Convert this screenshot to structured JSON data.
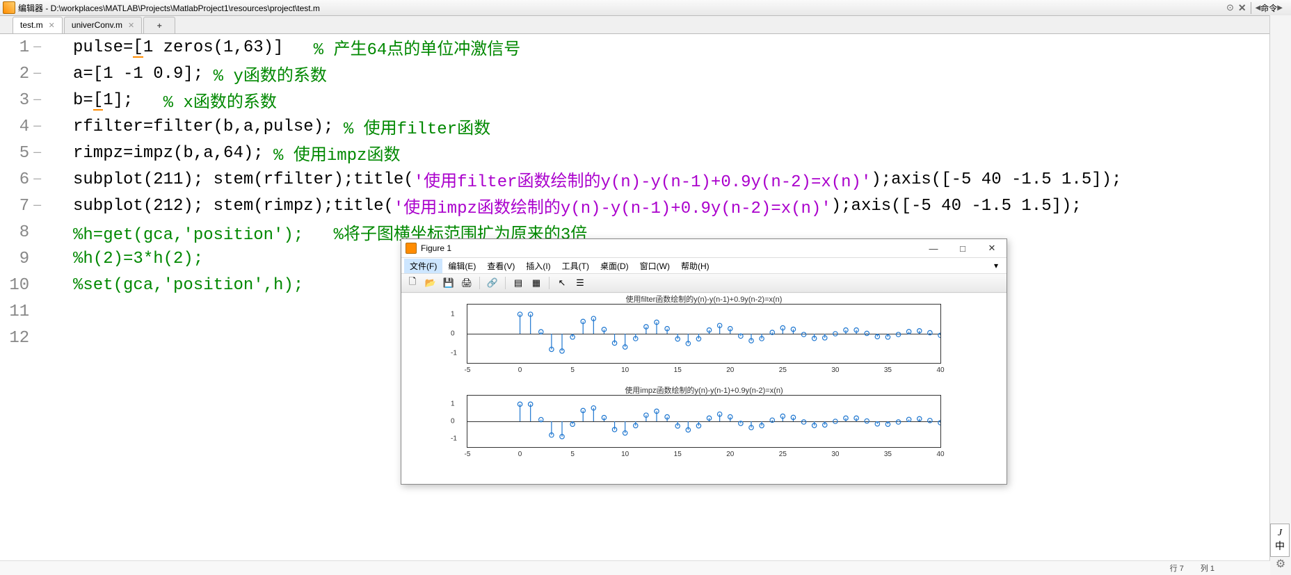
{
  "window": {
    "title": "编辑器 - D:\\workplaces\\MATLAB\\Projects\\MatlabProject1\\resources\\project\\test.m",
    "panel_btn": "命令"
  },
  "tabs": [
    {
      "label": "test.m",
      "active": true
    },
    {
      "label": "univerConv.m",
      "active": false
    }
  ],
  "code_lines": [
    {
      "n": 1,
      "dash": true,
      "segs": [
        [
          "plain",
          "pulse="
        ],
        [
          "ul",
          "["
        ],
        [
          "plain",
          "1 zeros(1,63)]   "
        ],
        [
          "cmt",
          "% 产生64点的单位冲激信号"
        ]
      ]
    },
    {
      "n": 2,
      "dash": true,
      "segs": [
        [
          "plain",
          "a=[1 -1 0.9]; "
        ],
        [
          "cmt",
          "% y函数的系数"
        ]
      ]
    },
    {
      "n": 3,
      "dash": true,
      "segs": [
        [
          "plain",
          "b="
        ],
        [
          "ul",
          "["
        ],
        [
          "plain",
          "1];   "
        ],
        [
          "cmt",
          "% x函数的系数"
        ]
      ]
    },
    {
      "n": 4,
      "dash": true,
      "segs": [
        [
          "plain",
          "rfilter=filter(b,a,pulse); "
        ],
        [
          "cmt",
          "% 使用filter函数"
        ]
      ]
    },
    {
      "n": 5,
      "dash": true,
      "segs": [
        [
          "plain",
          "rimpz=impz(b,a,64); "
        ],
        [
          "cmt",
          "% 使用impz函数"
        ]
      ]
    },
    {
      "n": 6,
      "dash": true,
      "segs": [
        [
          "plain",
          "subplot(211); stem(rfilter);title("
        ],
        [
          "str",
          "'使用filter函数绘制的y(n)-y(n-1)+0.9y(n-2)=x(n)'"
        ],
        [
          "plain",
          ");axis([-5 40 -1.5 1.5]);"
        ]
      ]
    },
    {
      "n": 7,
      "dash": true,
      "segs": [
        [
          "plain",
          "subplot(212); stem(rimpz);title("
        ],
        [
          "str",
          "'使用impz函数绘制的y(n)-y(n-1)+0.9y(n-2)=x(n)'"
        ],
        [
          "plain",
          ");axis([-5 40 -1.5 1.5]);"
        ]
      ]
    },
    {
      "n": 8,
      "dash": false,
      "segs": [
        [
          "cmt",
          "%h=get(gca,'position');   %将子图横坐标范围扩为原来的3倍"
        ]
      ]
    },
    {
      "n": 9,
      "dash": false,
      "segs": [
        [
          "cmt",
          "%h(2)=3*h(2);"
        ]
      ]
    },
    {
      "n": 10,
      "dash": false,
      "segs": [
        [
          "cmt",
          "%set(gca,'position',h);"
        ]
      ]
    },
    {
      "n": 11,
      "dash": false,
      "segs": []
    },
    {
      "n": 12,
      "dash": false,
      "segs": []
    }
  ],
  "figure": {
    "title": "Figure 1",
    "menu": [
      "文件(F)",
      "编辑(E)",
      "查看(V)",
      "插入(I)",
      "工具(T)",
      "桌面(D)",
      "窗口(W)",
      "帮助(H)"
    ],
    "plot1": {
      "title": "使用filter函数绘制的y(n)-y(n-1)+0.9y(n-2)=x(n)"
    },
    "plot2": {
      "title": "使用impz函数绘制的y(n)-y(n-1)+0.9y(n-2)=x(n)"
    },
    "yticks": [
      "1",
      "0",
      "-1"
    ],
    "xticks": [
      "-5",
      "0",
      "5",
      "10",
      "15",
      "20",
      "25",
      "30",
      "35",
      "40"
    ]
  },
  "status": {
    "line_label": "行",
    "line": "7",
    "col_label": "列",
    "col": "1"
  },
  "ime": {
    "a": "J",
    "b": "中"
  },
  "chart_data": [
    {
      "type": "stem",
      "title": "使用filter函数绘制的y(n)-y(n-1)+0.9y(n-2)=x(n)",
      "xlabel": "",
      "ylabel": "",
      "xlim": [
        -5,
        40
      ],
      "ylim": [
        -1.5,
        1.5
      ],
      "x": [
        0,
        1,
        2,
        3,
        4,
        5,
        6,
        7,
        8,
        9,
        10,
        11,
        12,
        13,
        14,
        15,
        16,
        17,
        18,
        19,
        20,
        21,
        22,
        23,
        24,
        25,
        26,
        27,
        28,
        29,
        30,
        31,
        32,
        33,
        34,
        35,
        36,
        37,
        38,
        39,
        40
      ],
      "y": [
        1.0,
        1.0,
        0.1,
        -0.8,
        -0.89,
        -0.17,
        0.63,
        0.78,
        0.22,
        -0.48,
        -0.68,
        -0.25,
        0.36,
        0.59,
        0.26,
        -0.27,
        -0.5,
        -0.26,
        0.19,
        0.42,
        0.26,
        -0.12,
        -0.36,
        -0.25,
        0.07,
        0.3,
        0.23,
        -0.04,
        -0.24,
        -0.21,
        0.0,
        0.19,
        0.19,
        0.02,
        -0.15,
        -0.17,
        -0.04,
        0.11,
        0.15,
        0.05,
        -0.08
      ]
    },
    {
      "type": "stem",
      "title": "使用impz函数绘制的y(n)-y(n-1)+0.9y(n-2)=x(n)",
      "xlabel": "",
      "ylabel": "",
      "xlim": [
        -5,
        40
      ],
      "ylim": [
        -1.5,
        1.5
      ],
      "x": [
        0,
        1,
        2,
        3,
        4,
        5,
        6,
        7,
        8,
        9,
        10,
        11,
        12,
        13,
        14,
        15,
        16,
        17,
        18,
        19,
        20,
        21,
        22,
        23,
        24,
        25,
        26,
        27,
        28,
        29,
        30,
        31,
        32,
        33,
        34,
        35,
        36,
        37,
        38,
        39,
        40
      ],
      "y": [
        1.0,
        1.0,
        0.1,
        -0.8,
        -0.89,
        -0.17,
        0.63,
        0.78,
        0.22,
        -0.48,
        -0.68,
        -0.25,
        0.36,
        0.59,
        0.26,
        -0.27,
        -0.5,
        -0.26,
        0.19,
        0.42,
        0.26,
        -0.12,
        -0.36,
        -0.25,
        0.07,
        0.3,
        0.23,
        -0.04,
        -0.24,
        -0.21,
        0.0,
        0.19,
        0.19,
        0.02,
        -0.15,
        -0.17,
        -0.04,
        0.11,
        0.15,
        0.05,
        -0.08
      ]
    }
  ]
}
